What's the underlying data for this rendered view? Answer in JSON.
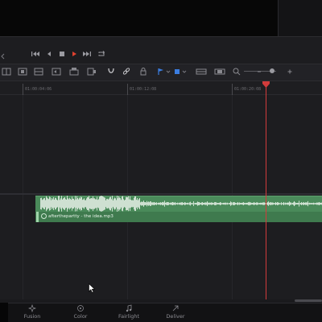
{
  "toolbar": {
    "flag_color": "#3b7de0",
    "marker_color": "#3b7de0"
  },
  "ruler": {
    "timecodes": [
      "01:00:04:06",
      "01:00:12:08",
      "01:00:20:08"
    ]
  },
  "timeline": {
    "audio_clip_name": "afterthepartty - the idea.mp3"
  },
  "pages": [
    {
      "label": "Fusion",
      "icon": "fusion-icon"
    },
    {
      "label": "Color",
      "icon": "color-icon"
    },
    {
      "label": "Fairlight",
      "icon": "fairlight-icon"
    },
    {
      "label": "Deliver",
      "icon": "deliver-icon"
    }
  ],
  "colors": {
    "accent_red": "#d23b3b",
    "clip_green": "#4a8a5a"
  }
}
